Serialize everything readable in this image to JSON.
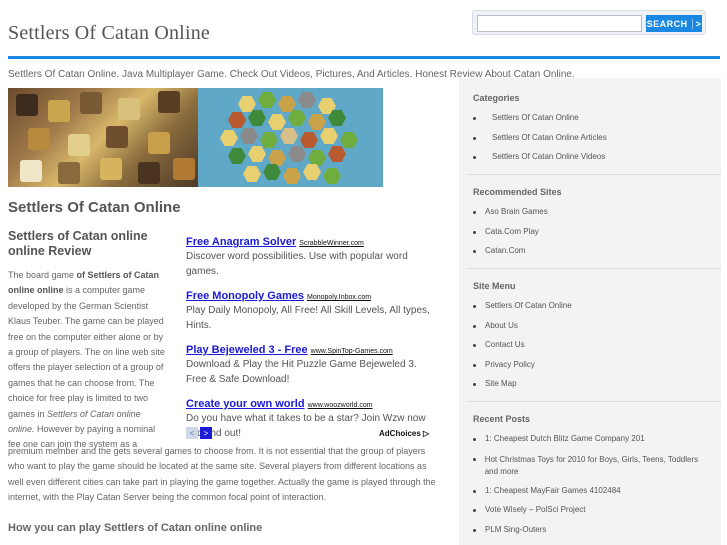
{
  "header": {
    "site_title": "Settlers Of Catan Online",
    "search_placeholder": "",
    "search_label": "SEARCH",
    "search_chevron": ">"
  },
  "tagline": "Settlers Of Catan Online. Java Multiplayer Game. Check Out Videos, Pictures, And Articles. Honest Review About Catan Online.",
  "main": {
    "page_title": "Settlers Of Catan Online",
    "article_title": "Settlers of Catan online online Review",
    "intro_prefix": "The board game ",
    "intro_bold": "of Settlers of Catan online online",
    "intro_text": " is a computer game developed by the German Scientist Klaus Teuber. The game can be played free on the computer either alone or by a group of players. The on line web site offers the player selection of a group of games that he can choose from. The choice for free play is limited to two games in ",
    "intro_italic": "Settlers of Catan online online.",
    "intro_tail": " However by paying a nominal fee one can join the system as a",
    "continuation": "premium member and the gets several games to choose from. It is not essential that the group of players who want to play the game should be located at the same site. Several players from different locations as well even different cities can take part in playing the game together. Actually the game is played through the internet, with the Play Catan Server being the common focal point of interaction.",
    "subheading": "How you can play Settlers of Catan online online"
  },
  "ads": [
    {
      "title": "Free Anagram Solver",
      "url": "ScrabbleWinner.com",
      "desc": "Discover word possibilities. Use with popular word games."
    },
    {
      "title": "Free Monopoly Games",
      "url": "Monopoly.Inbox.com",
      "desc": "Play Daily Monopoly, All Free! All Skill Levels, All types, Hints."
    },
    {
      "title": "Play Bejeweled 3 - Free",
      "url": "www.SpinTop-Games.com",
      "desc": "Download & Play the Hit Puzzle Game Bejeweled 3. Free & Safe Download!"
    },
    {
      "title": "Create your own world",
      "url": "www.woozworld.com",
      "desc": "Do you have what it takes to be a star? Join Wzw now and find out!"
    }
  ],
  "ad_nav": {
    "prev": "<",
    "next": ">",
    "adchoices": "AdChoices"
  },
  "sidebar": {
    "categories_title": "Categories",
    "categories": [
      "Settlers Of Catan Online",
      "Settlers Of Catan Online Articles",
      "Settlers Of Catan Online Videos"
    ],
    "recommended_title": "Recommended Sites",
    "recommended": [
      "Aso Brain Games",
      "Cata.Com Play",
      "Catan.Com"
    ],
    "menu_title": "Site Menu",
    "menu": [
      "Settlers Of Catan Online",
      "About Us",
      "Contact Us",
      "Privacy Policy",
      "Site Map"
    ],
    "recent_title": "Recent Posts",
    "recent": [
      "1: Cheapest Dutch Blitz Game Company 201",
      "Hot Christmas Toys for 2010 for Boys, Girls, Teens, Toddlers and more",
      "1: Cheapest MayFair Games 4102484",
      "Vote Wisely – PolSci Project",
      "PLM Sing-Outers"
    ]
  },
  "colors": {
    "accent": "#1a87e0",
    "ad_link": "#1a1ad8"
  }
}
